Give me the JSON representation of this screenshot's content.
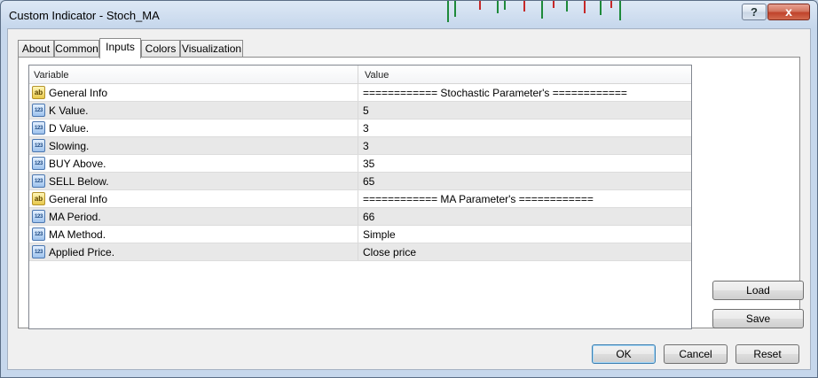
{
  "window": {
    "title": "Custom Indicator - Stoch_MA"
  },
  "title_buttons": {
    "help_glyph": "?",
    "close_glyph": "x"
  },
  "tabs": [
    {
      "label": "About",
      "active": false
    },
    {
      "label": "Common",
      "active": false
    },
    {
      "label": "Inputs",
      "active": true
    },
    {
      "label": "Colors",
      "active": false
    },
    {
      "label": "Visualization",
      "active": false
    }
  ],
  "grid": {
    "columns": [
      "Variable",
      "Value"
    ],
    "rows": [
      {
        "icon": "ab",
        "icon_name": "string-type-icon",
        "variable": "General Info",
        "value": "============ Stochastic Parameter's ============"
      },
      {
        "icon": "123",
        "icon_name": "number-type-icon",
        "variable": "K Value.",
        "value": "5"
      },
      {
        "icon": "123",
        "icon_name": "number-type-icon",
        "variable": "D Value.",
        "value": "3"
      },
      {
        "icon": "123",
        "icon_name": "number-type-icon",
        "variable": "Slowing.",
        "value": "3"
      },
      {
        "icon": "123",
        "icon_name": "number-type-icon",
        "variable": "BUY Above.",
        "value": "35"
      },
      {
        "icon": "123",
        "icon_name": "number-type-icon",
        "variable": "SELL Below.",
        "value": "65"
      },
      {
        "icon": "ab",
        "icon_name": "string-type-icon",
        "variable": "General Info",
        "value": "============ MA Parameter's ============"
      },
      {
        "icon": "123",
        "icon_name": "number-type-icon",
        "variable": "MA Period.",
        "value": "66"
      },
      {
        "icon": "123",
        "icon_name": "number-type-icon",
        "variable": "MA Method.",
        "value": "Simple"
      },
      {
        "icon": "123",
        "icon_name": "number-type-icon",
        "variable": "Applied Price.",
        "value": "Close price"
      }
    ]
  },
  "side_buttons": {
    "load": "Load",
    "save": "Save"
  },
  "buttons": {
    "ok": "OK",
    "cancel": "Cancel",
    "reset": "Reset"
  },
  "colors": {
    "title_bg": "#c6d7ec",
    "close_button": "#c0432b",
    "row_alt": "#e8e8e8",
    "default_button_border": "#3c7fb1"
  }
}
